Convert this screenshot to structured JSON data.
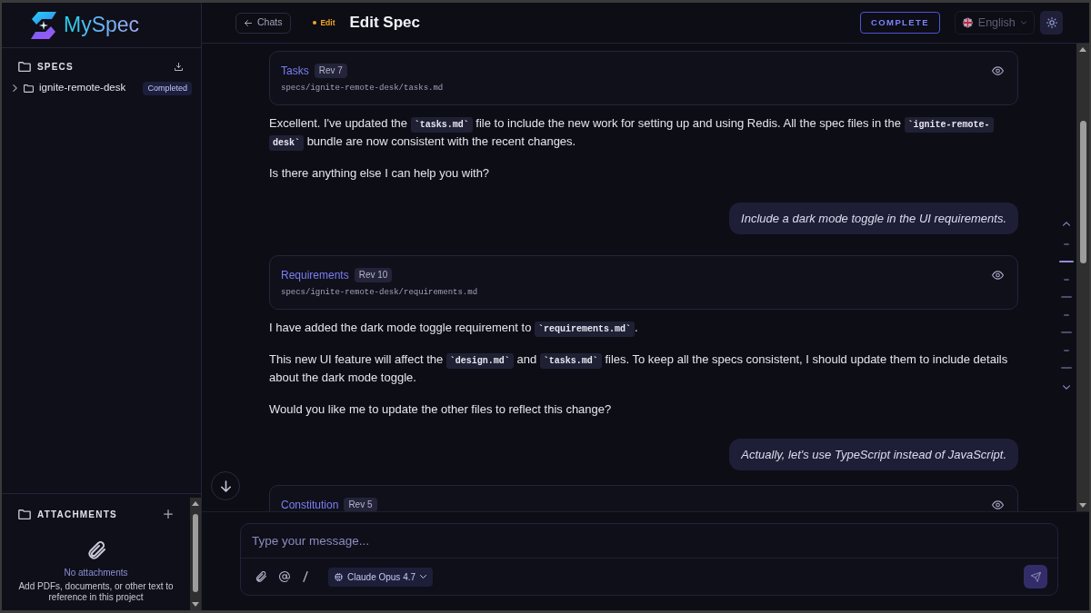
{
  "sidebar": {
    "brand": "MySpec",
    "specs": {
      "title": "SPECS",
      "items": [
        {
          "name": "ignite-remote-desk",
          "status": "Completed",
          "expanded": false
        }
      ]
    },
    "attachments": {
      "title": "ATTACHMENTS",
      "empty_title": "No attachments",
      "empty_text": "Add PDFs, documents, or other text to reference in this project"
    }
  },
  "header": {
    "back": "Chats",
    "mode": "Edit",
    "title": "Edit Spec",
    "complete_label": "COMPLETE",
    "language": "English"
  },
  "messages": [
    {
      "kind": "assistant",
      "spec": {
        "title": "Tasks",
        "rev": "Rev 7",
        "path": "specs/ignite-remote-desk/tasks.md"
      },
      "paragraphs": [
        {
          "parts": [
            {
              "kind": "text",
              "text": "Excellent. I've updated the "
            },
            {
              "kind": "code",
              "text": "`tasks.md`"
            },
            {
              "kind": "text",
              "text": " file to include the new work for setting up and using Redis. All the spec files in the "
            },
            {
              "kind": "code",
              "text": "`ignite-remote-desk`"
            },
            {
              "kind": "text",
              "text": " bundle are now consistent with the recent changes."
            }
          ]
        },
        {
          "parts": [
            {
              "kind": "text",
              "text": "Is there anything else I can help you with?"
            }
          ]
        }
      ]
    },
    {
      "kind": "user",
      "text": "Include a dark mode toggle in the UI requirements."
    },
    {
      "kind": "assistant",
      "spec": {
        "title": "Requirements",
        "rev": "Rev 10",
        "path": "specs/ignite-remote-desk/requirements.md"
      },
      "paragraphs": [
        {
          "parts": [
            {
              "kind": "text",
              "text": "I have added the dark mode toggle requirement to "
            },
            {
              "kind": "code",
              "text": "`requirements.md`"
            },
            {
              "kind": "text",
              "text": "."
            }
          ]
        },
        {
          "parts": [
            {
              "kind": "text",
              "text": "This new UI feature will affect the "
            },
            {
              "kind": "code",
              "text": "`design.md`"
            },
            {
              "kind": "text",
              "text": " and "
            },
            {
              "kind": "code",
              "text": "`tasks.md`"
            },
            {
              "kind": "text",
              "text": " files. To keep all the specs consistent, I should update them to include details about the dark mode toggle."
            }
          ]
        },
        {
          "parts": [
            {
              "kind": "text",
              "text": "Would you like me to update the other files to reflect this change?"
            }
          ]
        }
      ]
    },
    {
      "kind": "user",
      "text": "Actually, let's use TypeScript instead of JavaScript."
    },
    {
      "kind": "assistant",
      "spec": {
        "title": "Constitution",
        "rev": "Rev 5"
      }
    }
  ],
  "message_nav": {
    "marks": [
      {
        "kind": "short",
        "selected": false
      },
      {
        "kind": "long",
        "selected": true
      },
      {
        "kind": "short",
        "selected": false
      },
      {
        "kind": "long",
        "selected": false
      },
      {
        "kind": "short",
        "selected": false
      },
      {
        "kind": "long",
        "selected": false
      },
      {
        "kind": "short",
        "selected": false
      },
      {
        "kind": "long",
        "selected": false
      }
    ]
  },
  "composer": {
    "placeholder": "Type your message...",
    "model": "Claude Opus 4.7",
    "send_disabled": true
  }
}
